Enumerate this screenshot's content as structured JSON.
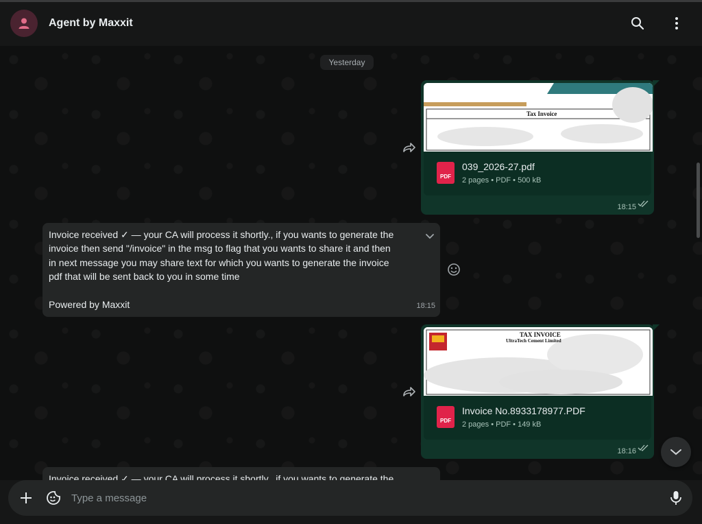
{
  "header": {
    "title": "Agent by Maxxit"
  },
  "chat": {
    "date_chip": "Yesterday",
    "messages": [
      {
        "type": "document",
        "preview_heading": "Tax Invoice",
        "file_name": "039_2026-27.pdf",
        "meta": "2 pages • PDF • 500 kB",
        "time": "18:15",
        "icon_label": "PDF"
      },
      {
        "type": "text",
        "text": "Invoice received ✓ — your CA will process it shortly., if you wants to generate the invoice then send \"/invoice\" in the msg to flag that you wants to share it and then in next message you may share text for which you wants to generate the invoice pdf that will be sent back to you in some time",
        "footer": "Powered by Maxxit",
        "time": "18:15"
      },
      {
        "type": "document",
        "preview_heading": "TAX INVOICE",
        "preview_subheading": "UltraTech Cement Limited",
        "file_name": "Invoice No.8933178977.PDF",
        "meta": "2 pages • PDF • 149 kB",
        "time": "18:16",
        "icon_label": "PDF"
      },
      {
        "type": "text",
        "text": "Invoice received ✓ — your CA will process it shortly., if you wants to generate the"
      }
    ]
  },
  "composer": {
    "placeholder": "Type a message",
    "value": ""
  },
  "colors": {
    "outgoing_bubble": "#103529",
    "incoming_bubble": "#242626",
    "pdf_icon": "#e0234a",
    "avatar": "#e26d89"
  }
}
